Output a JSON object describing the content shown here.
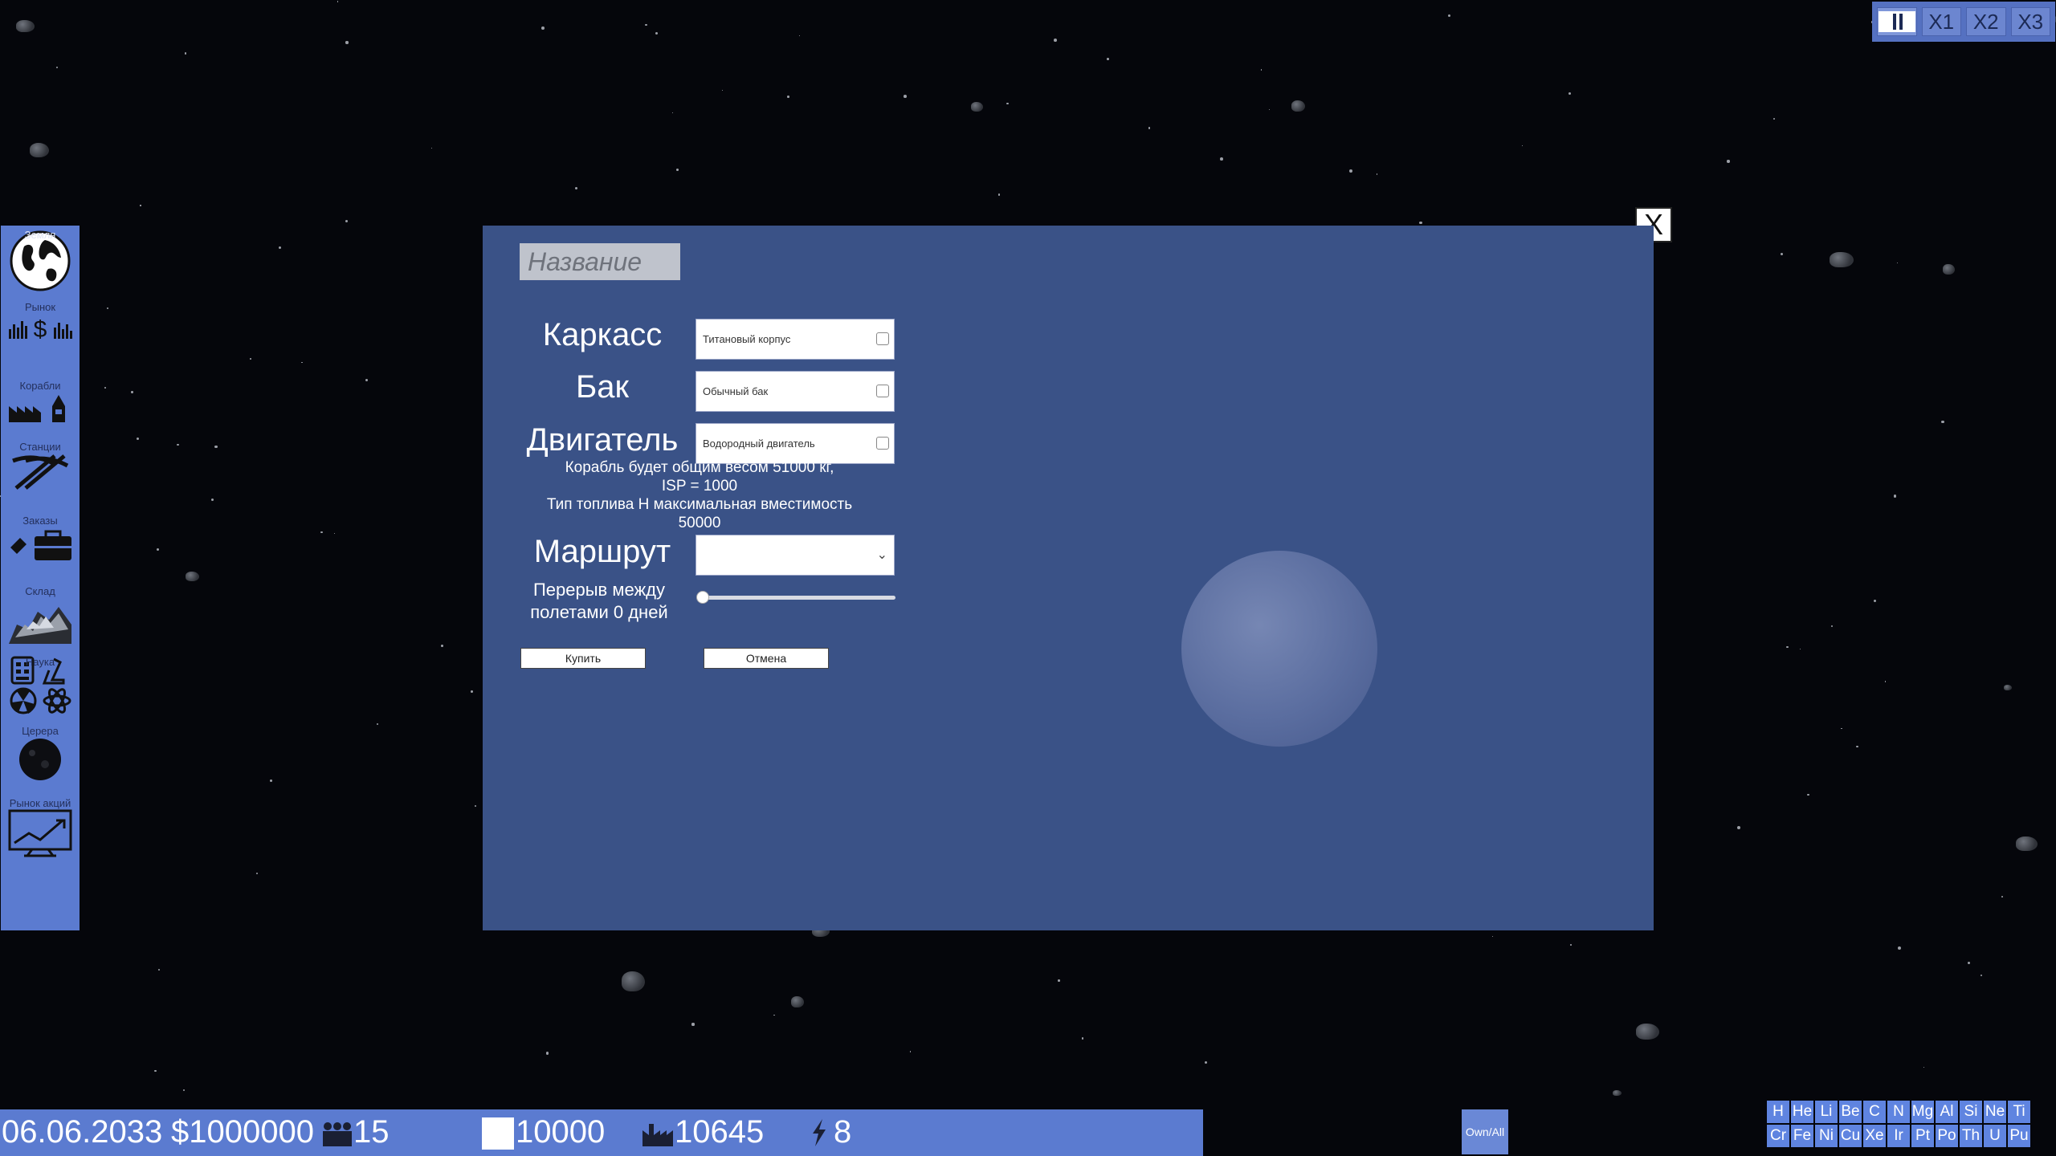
{
  "speed_controls": {
    "pause_icon": "pause-icon",
    "x1": "X1",
    "x2": "X2",
    "x3": "X3"
  },
  "sidebar": {
    "items": [
      {
        "label": "Земля",
        "icon": "globe-icon"
      },
      {
        "label": "Рынок",
        "icon": "market-icon"
      },
      {
        "label": "Корабли",
        "icon": "shipyard-icon"
      },
      {
        "label": "Станции",
        "icon": "mining-icon"
      },
      {
        "label": "Заказы",
        "icon": "orders-icon"
      },
      {
        "label": "Склад",
        "icon": "warehouse-icon"
      },
      {
        "label": "Наука",
        "icon": "science-icon"
      },
      {
        "label": "Церера",
        "icon": "ceres-icon"
      },
      {
        "label": "Рынок акций",
        "icon": "stock-chart-icon"
      }
    ]
  },
  "dialog": {
    "name_placeholder": "Название",
    "close_label": "X",
    "hull_label": "Каркасс",
    "hull_value": "Титановый корпус",
    "tank_label": "Бак",
    "tank_value": "Обычный бак",
    "engine_label": "Двигатель",
    "engine_value": "Водородный двигатель",
    "info_line1": "Корабль будет общим весом 51000  кг,",
    "info_line2": "ISP = 1000",
    "info_line3": "Тип топлива H максимальная вместимость",
    "info_line4": "50000",
    "route_label": "Маршрут",
    "route_value": "",
    "break_label_line1": "Перерыв между",
    "break_label_line2": "полетами 0 дней",
    "break_days": 0,
    "buy_label": "Купить",
    "cancel_label": "Отмена"
  },
  "status": {
    "date": "06.06.2033",
    "money": "$1000000",
    "population": "15",
    "box_value": "10000",
    "factory_value": "10645",
    "energy": "8"
  },
  "own_all_label": "Own/All",
  "elements": [
    "H",
    "He",
    "Li",
    "Be",
    "C",
    "N",
    "Mg",
    "Al",
    "Si",
    "Ne",
    "Ti",
    "Cr",
    "Fe",
    "Ni",
    "Cu",
    "Xe",
    "Ir",
    "Pt",
    "Po",
    "Th",
    "U",
    "Pu"
  ],
  "colors": {
    "panel": "#5b7bd0",
    "dialog": "#3a5287",
    "space": "#05060b"
  }
}
